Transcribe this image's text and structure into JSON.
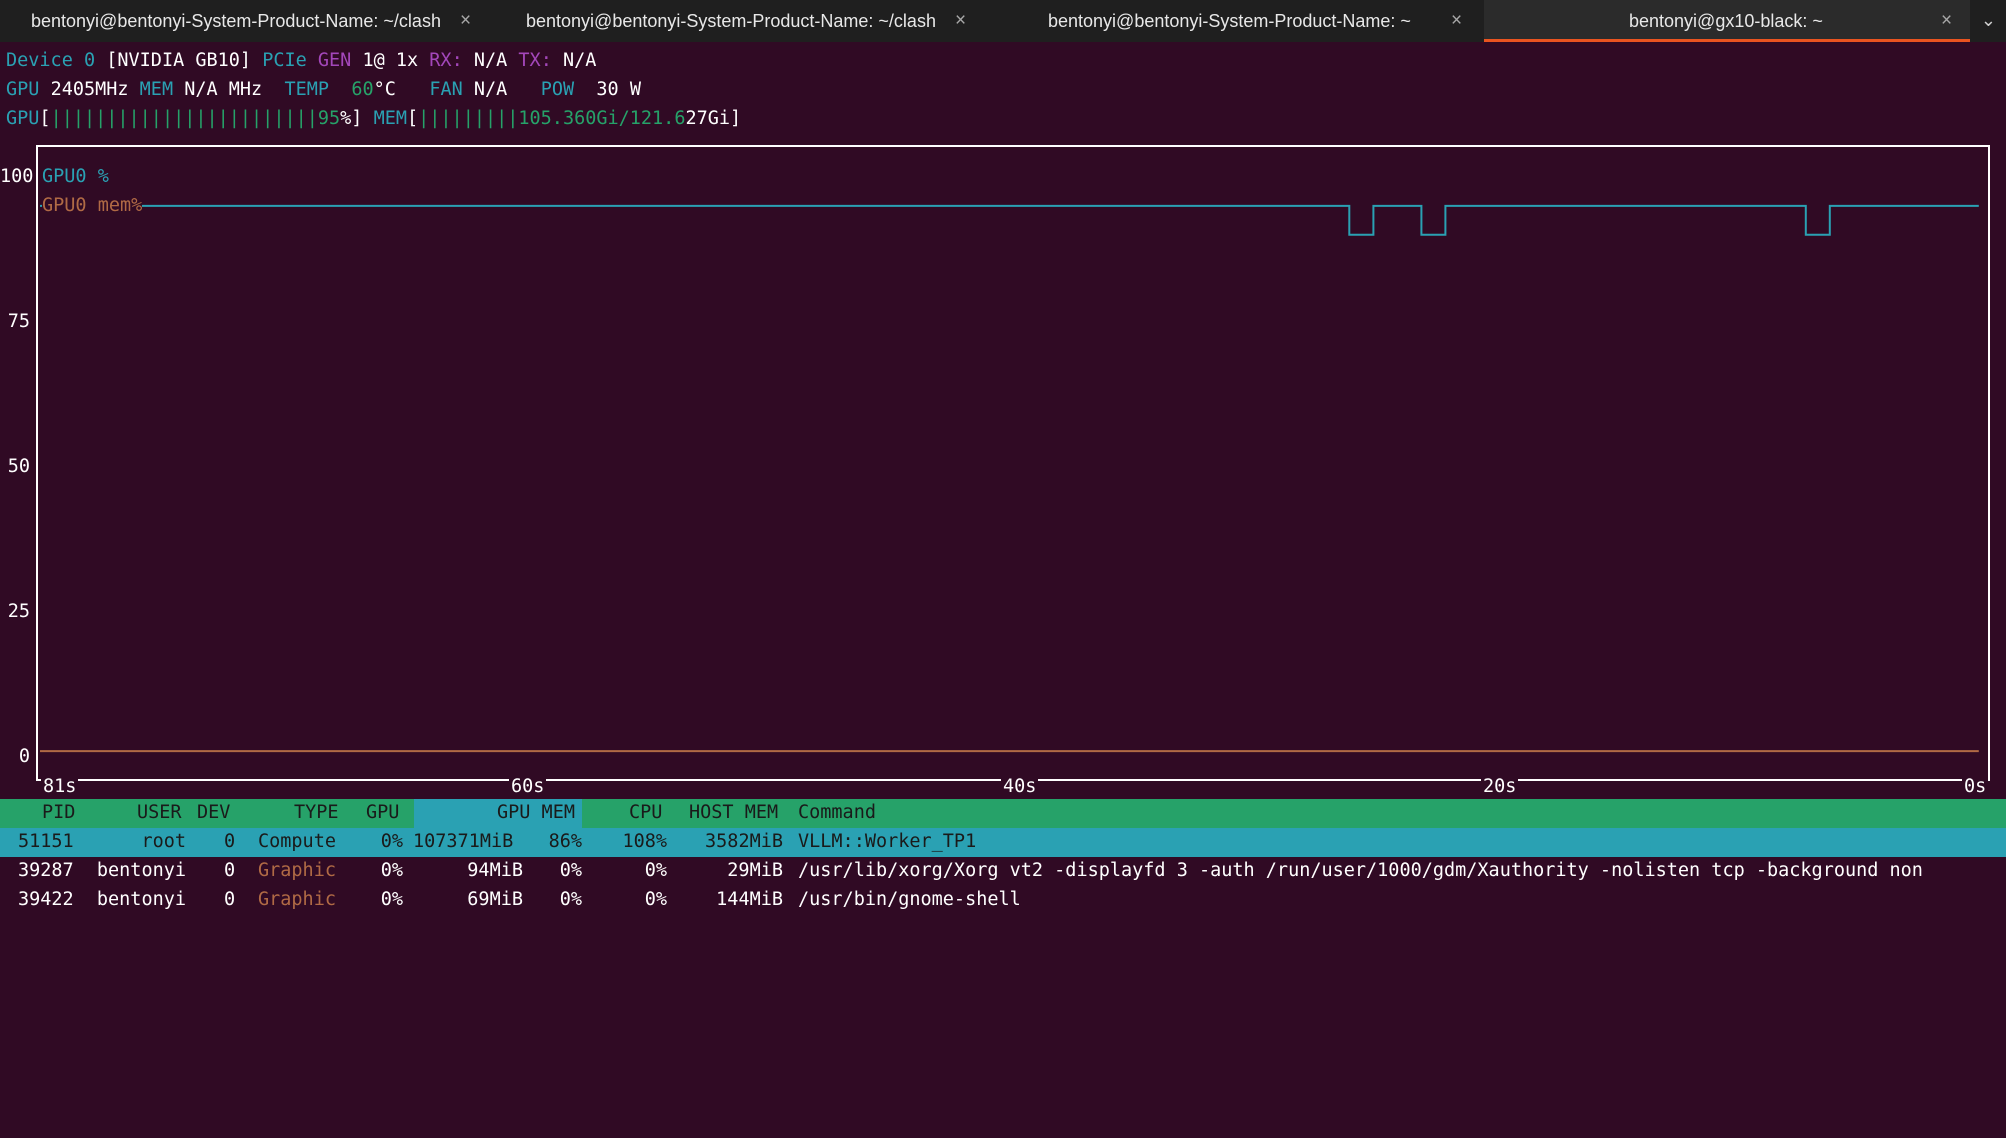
{
  "tabs": [
    {
      "title": "bentonyi@bentonyi-System-Product-Name: ~/clash",
      "active": false
    },
    {
      "title": "bentonyi@bentonyi-System-Product-Name: ~/clash",
      "active": false
    },
    {
      "title": "bentonyi@bentonyi-System-Product-Name: ~",
      "active": false
    },
    {
      "title": "bentonyi@gx10-black: ~",
      "active": true
    }
  ],
  "tab_close_glyph": "×",
  "tab_menu_glyph": "⌄",
  "device": {
    "label": "Device",
    "index": "0",
    "name": "[NVIDIA GB10]",
    "pcie_label": "PCIe",
    "gen_label": "GEN",
    "gen_value": "1@ 1x",
    "rx_label": "RX:",
    "rx_value": "N/A",
    "tx_label": "TX:",
    "tx_value": "N/A"
  },
  "stats": {
    "gpu_label": "GPU",
    "gpu_clock": "2405MHz",
    "mem_label": "MEM",
    "mem_clock": "N/A MHz",
    "temp_label": "TEMP",
    "temp_value": "60",
    "temp_unit": "°C",
    "fan_label": "FAN",
    "fan_value": "N/A",
    "pow_label": "POW",
    "pow_value": "30 W"
  },
  "bars": {
    "gpu_label": "GPU",
    "gpu_open": "[",
    "gpu_bars": "||||||||||||||||||||||||",
    "gpu_pct": "95",
    "gpu_close": "%]",
    "mem_label": "MEM",
    "mem_open": "[",
    "mem_bars": "|||||||||",
    "mem_used": "105.360Gi/121.6",
    "mem_total_tail": "27Gi",
    "mem_close": "]"
  },
  "chart_data": {
    "type": "line",
    "legend": [
      "GPU0 %",
      "GPU0 mem%"
    ],
    "yticks": [
      "100",
      "75",
      "50",
      "25",
      "0"
    ],
    "xticks": [
      "81s",
      "60s",
      "40s",
      "20s",
      "0s"
    ],
    "ylim": [
      0,
      100
    ],
    "xlim": [
      81,
      0
    ],
    "series": [
      {
        "name": "GPU0 %",
        "color": "#2aa1b3",
        "x": [
          81,
          78,
          26.5,
          26.5,
          25.5,
          25.5,
          23.5,
          23.5,
          22.5,
          22.5,
          7.5,
          7.5,
          6.5,
          6.5,
          0.3
        ],
        "values": [
          95,
          95,
          95,
          90,
          90,
          95,
          95,
          90,
          90,
          95,
          95,
          90,
          90,
          95,
          95
        ]
      },
      {
        "name": "GPU0 mem%",
        "color": "#b06a45",
        "x": [
          81,
          0.3
        ],
        "values": [
          0.5,
          0.5
        ]
      }
    ]
  },
  "process_table": {
    "headers": [
      "PID",
      "USER",
      "DEV",
      "TYPE",
      "GPU",
      "GPU MEM",
      "CPU",
      "HOST MEM",
      "Command"
    ],
    "rows": [
      {
        "pid": "51151",
        "user": "root",
        "dev": "0",
        "type": "Compute",
        "gpu": "0%",
        "gpu_mem": "107371MiB",
        "gpu_mem_pct": "86%",
        "cpu": "108%",
        "host_mem": "3582MiB",
        "command": "VLLM::Worker_TP1"
      },
      {
        "pid": "39287",
        "user": "bentonyi",
        "dev": "0",
        "type": "Graphic",
        "gpu": "0%",
        "gpu_mem": "94MiB",
        "gpu_mem_pct": "0%",
        "cpu": "0%",
        "host_mem": "29MiB",
        "command": "/usr/lib/xorg/Xorg vt2 -displayfd 3 -auth /run/user/1000/gdm/Xauthority -nolisten tcp -background non"
      },
      {
        "pid": "39422",
        "user": "bentonyi",
        "dev": "0",
        "type": "Graphic",
        "gpu": "0%",
        "gpu_mem": "69MiB",
        "gpu_mem_pct": "0%",
        "cpu": "0%",
        "host_mem": "144MiB",
        "command": "/usr/bin/gnome-shell"
      }
    ]
  }
}
